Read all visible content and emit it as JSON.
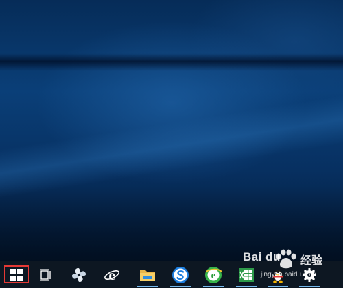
{
  "taskbar": {
    "items": [
      {
        "name": "start-button",
        "icon": "windows-logo-icon",
        "highlighted": true,
        "highlight_color": "#e53935"
      },
      {
        "name": "task-view-button",
        "icon": "task-view-icon"
      },
      {
        "name": "pinwheel-app-button",
        "icon": "pinwheel-icon"
      },
      {
        "name": "internet-explorer-button",
        "icon": "internet-explorer-icon"
      },
      {
        "name": "file-explorer-button",
        "icon": "folder-icon",
        "active": true
      },
      {
        "name": "sogou-browser-button",
        "icon": "sogou-s-icon",
        "active": true
      },
      {
        "name": "360-browser-button",
        "icon": "360-browser-icon",
        "active": true
      },
      {
        "name": "excel-button",
        "icon": "spreadsheet-icon",
        "active": true
      },
      {
        "name": "qq-button",
        "icon": "penguin-icon",
        "active": true
      },
      {
        "name": "settings-button",
        "icon": "gear-icon",
        "active": true
      }
    ],
    "active_indicator_color": "#76b9ed"
  },
  "watermark": {
    "brand": "Bai  du",
    "product": "经验",
    "url": "jingyan.baidu.com"
  },
  "colors": {
    "desktop": "#0a3f78",
    "taskbar": "#0d1722"
  }
}
